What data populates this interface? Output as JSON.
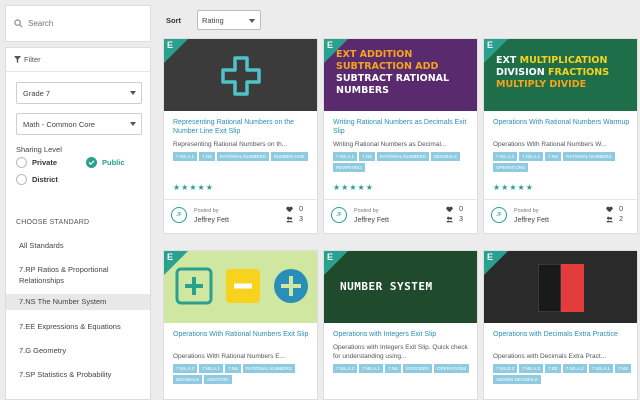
{
  "search": {
    "placeholder": "Search"
  },
  "filter": {
    "title": "Filter",
    "grade": "Grade 7",
    "subject": "Math - Common Core",
    "sharing_label": "Sharing Level",
    "sharing": {
      "private": "Private",
      "public": "Public",
      "district": "District",
      "selected": "Public"
    }
  },
  "standards": {
    "heading": "CHOOSE STANDARD",
    "items": [
      {
        "label": "All Standards"
      },
      {
        "label": "7.RP Ratios & Proportional Relationships"
      },
      {
        "label": "7.NS The Number System",
        "active": true
      },
      {
        "label": "7.EE Expressions & Equations"
      },
      {
        "label": "7.G Geometry"
      },
      {
        "label": "7.SP Statistics & Probability"
      }
    ]
  },
  "sort": {
    "label": "Sort",
    "value": "Rating"
  },
  "cards": [
    {
      "title": "Representing Rational Numbers on the Number Line Exit Slip",
      "desc": "Representing Rational Numbers on th...",
      "tags_row1": [
        "7.NS.A.1",
        "7.NS",
        "RATIONAL NUMBERS"
      ],
      "tags_row2": [
        "NUMBER LINE"
      ],
      "stars": "★★★★★",
      "posted_by": "Posted by",
      "author": "Jeffrey Fett",
      "initials": "JF",
      "likes": "0",
      "uses": "3",
      "thumb_text": "",
      "thumb_bg": "#3b3b3b"
    },
    {
      "title": "Writing Rational Numbers as Decimals Exit Slip",
      "desc": "Writing Rational Numbers as Decimal...",
      "tags_row1": [
        "7.NS.A.1",
        "7.NS",
        "RATIONAL NUMBERS"
      ],
      "tags_row2": [
        "DECIMALS",
        "REWRITING"
      ],
      "stars": "★★★★★",
      "posted_by": "Posted by",
      "author": "Jeffrey Fett",
      "initials": "JF",
      "likes": "0",
      "uses": "3",
      "thumb_text": "EXT ADDITION SUBTRACTION ADD SUBTRACT RATIONAL NUMBERS",
      "thumb_bg": "#5a2a6e"
    },
    {
      "title": "Operations With Rational Numbers Warmup",
      "desc": "Operations With Rational Numbers W...",
      "tags_row1": [
        "7.NS.A.2",
        "7.NS.A.1",
        "7.NS"
      ],
      "tags_row2": [
        "RATIONAL NUMBERS",
        "OPERATIONS"
      ],
      "stars": "★★★★★",
      "posted_by": "Posted by",
      "author": "Jeffrey Fett",
      "initials": "JF",
      "likes": "0",
      "uses": "2",
      "thumb_text": "EXT MULTIPLICATION DIVISION FRACTIONS MULTIPLY DIVIDE",
      "thumb_bg": "#1e6e4a"
    },
    {
      "title": "Operations With Rational Numbers Exit Slip",
      "desc": "Operations With Rational Numbers E...",
      "tags_row1": [
        "7.NS.A.2",
        "7.NS.A.1",
        "7.NS"
      ],
      "tags_row2": [
        "RATIONAL NUMBERS",
        "DECIMALS",
        "ADDITION"
      ],
      "thumb_bg": "#cfe7a0"
    },
    {
      "title": "Operations with Integers Exit Slip",
      "desc": "Operations with Integers Exit Slip. Quick check for understanding using...",
      "tags_row1": [
        "7.NS.A.2",
        "7.NS.A.1",
        "7.NS",
        "INTEGERS",
        "OPERATIONS"
      ],
      "tags_row2": [],
      "thumb_text": "NUMBER SYSTEM",
      "thumb_bg": "#1f4a2c"
    },
    {
      "title": "Operations with Decimals Extra Practice",
      "desc": "Operations with Decimals Extra Pract...",
      "tags_row1": [
        "7.NS.B.3",
        "7.NS.A.2",
        "7.EE",
        "7.NS.A.2"
      ],
      "tags_row2": [
        "7.NS.A.1",
        "7.NS",
        "ADDING DECIMALS"
      ],
      "thumb_bg": "#2a2a2a"
    }
  ],
  "logo_letter": "E",
  "colors": {
    "accent": "#2aa08e",
    "link": "#2a8fb8",
    "tag": "#8ecbe0"
  }
}
